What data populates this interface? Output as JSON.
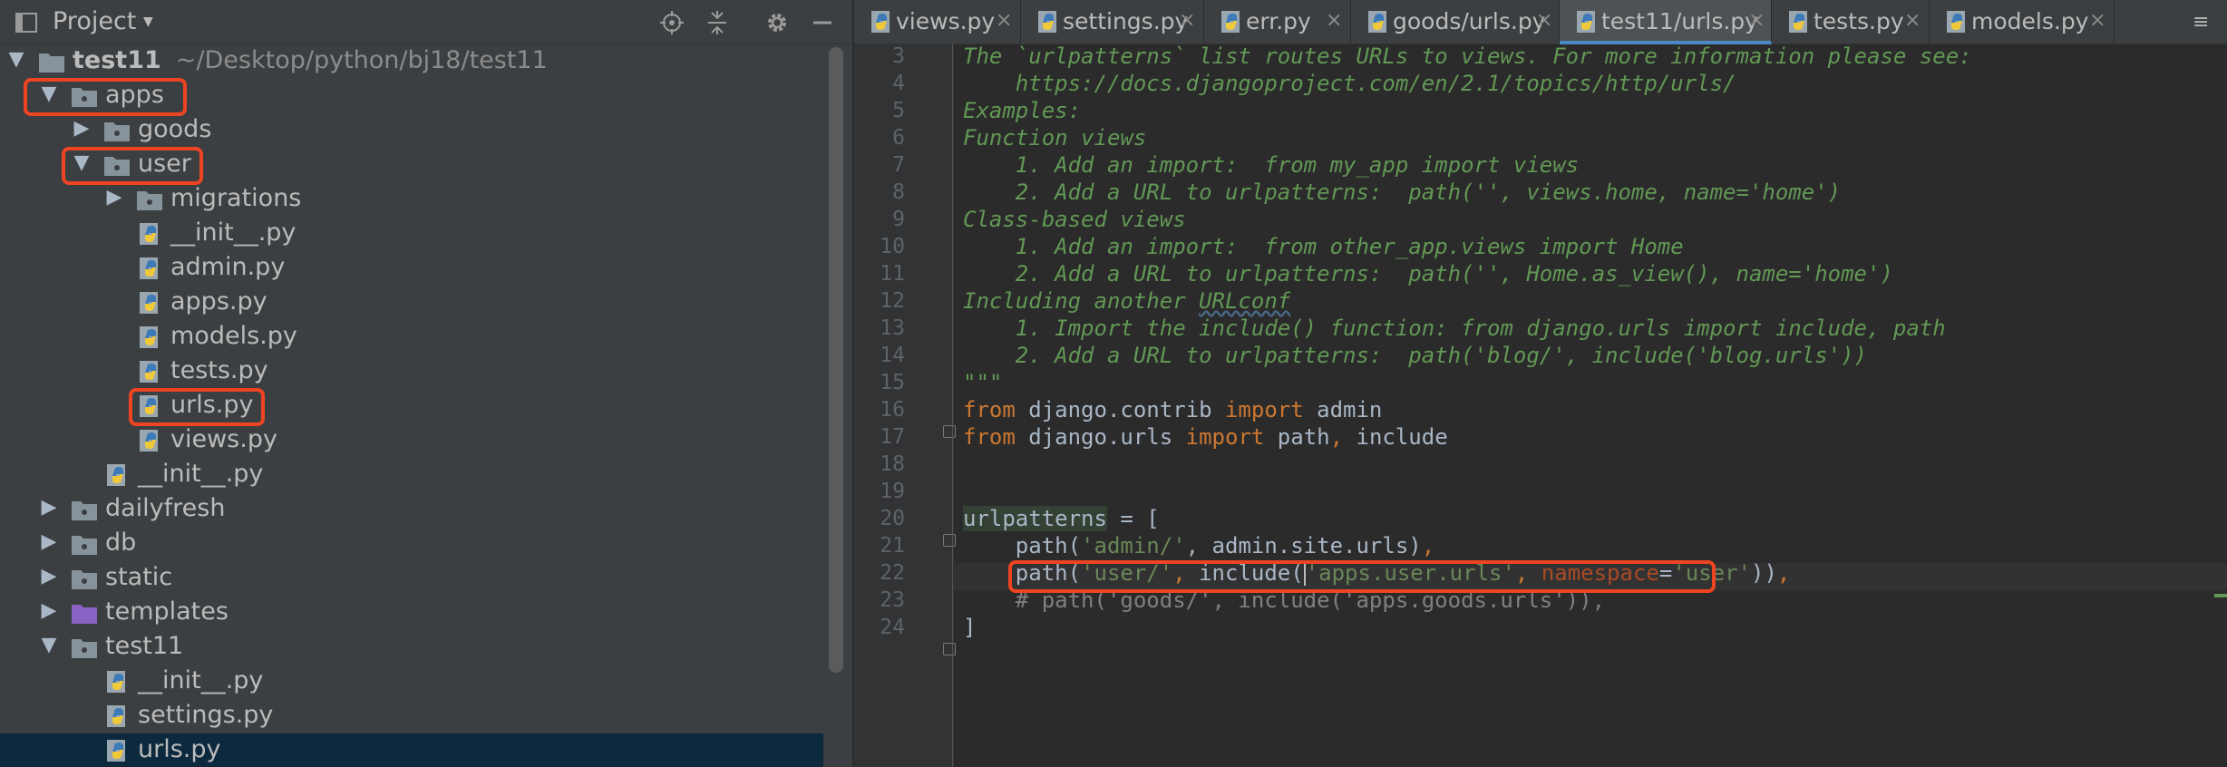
{
  "project_panel": {
    "title": "Project",
    "caret": "▼",
    "tree": [
      {
        "id": "test11",
        "label": "test11",
        "path": "~/Desktop/python/bj18/test11",
        "expanded": true,
        "type": "module"
      },
      {
        "id": "apps",
        "label": "apps",
        "expanded": true,
        "type": "folder"
      },
      {
        "id": "goods",
        "label": "goods",
        "expanded": false,
        "type": "folder"
      },
      {
        "id": "user",
        "label": "user",
        "expanded": true,
        "type": "folder"
      },
      {
        "id": "migrations",
        "label": "migrations",
        "expanded": false,
        "type": "folder"
      },
      {
        "id": "user-init",
        "label": "__init__.py",
        "type": "python"
      },
      {
        "id": "admin",
        "label": "admin.py",
        "type": "python"
      },
      {
        "id": "apps-py",
        "label": "apps.py",
        "type": "python"
      },
      {
        "id": "models",
        "label": "models.py",
        "type": "python"
      },
      {
        "id": "tests",
        "label": "tests.py",
        "type": "python"
      },
      {
        "id": "user-urls",
        "label": "urls.py",
        "type": "python"
      },
      {
        "id": "views",
        "label": "views.py",
        "type": "python"
      },
      {
        "id": "apps-init",
        "label": "__init__.py",
        "type": "python"
      },
      {
        "id": "dailyfresh",
        "label": "dailyfresh",
        "expanded": false,
        "type": "folder"
      },
      {
        "id": "db",
        "label": "db",
        "expanded": false,
        "type": "folder"
      },
      {
        "id": "static",
        "label": "static",
        "expanded": false,
        "type": "folder"
      },
      {
        "id": "templates",
        "label": "templates",
        "expanded": false,
        "type": "templates-folder"
      },
      {
        "id": "test11-pkg",
        "label": "test11",
        "expanded": true,
        "type": "folder"
      },
      {
        "id": "test11-init",
        "label": "__init__.py",
        "type": "python"
      },
      {
        "id": "settings",
        "label": "settings.py",
        "type": "python"
      },
      {
        "id": "test11-urls",
        "label": "urls.py",
        "type": "python",
        "selected": true
      }
    ]
  },
  "tabs": [
    {
      "label": "views.py",
      "close": "×"
    },
    {
      "label": "settings.py",
      "close": "×"
    },
    {
      "label": "err.py",
      "close": "×"
    },
    {
      "label": "goods/urls.py",
      "close": "×"
    },
    {
      "label": "test11/urls.py",
      "close": "×",
      "active": true
    },
    {
      "label": "tests.py",
      "close": "×"
    },
    {
      "label": "models.py",
      "close": "×"
    }
  ],
  "tab_overflow": "≡",
  "editor": {
    "line_numbers": [
      "3",
      "4",
      "5",
      "6",
      "7",
      "8",
      "9",
      "10",
      "11",
      "12",
      "13",
      "14",
      "15",
      "16",
      "17",
      "18",
      "19",
      "20",
      "21",
      "22",
      "23",
      "24"
    ],
    "lines": {
      "l3": "The `urlpatterns` list routes URLs to views. For more information please see:",
      "l4": "    https://docs.djangoproject.com/en/2.1/topics/http/urls/",
      "l5": "Examples:",
      "l6": "Function views",
      "l7": "    1. Add an import:  from my_app import views",
      "l8": "    2. Add a URL to urlpatterns:  path('', views.home, name='home')",
      "l9": "Class-based views",
      "l10": "    1. Add an import:  from other_app.views import Home",
      "l11": "    2. Add a URL to urlpatterns:  path('', Home.as_view(), name='home')",
      "l12a": "Including another ",
      "l12b": "URLconf",
      "l13": "    1. Import the include() function: from django.urls import include, path",
      "l14": "    2. Add a URL to urlpatterns:  path('blog/', include('blog.urls'))",
      "l15": "\"\"\"",
      "l16_kw1": "from",
      "l16_mod": " django.contrib ",
      "l16_kw2": "import",
      "l16_name": " admin",
      "l17_kw1": "from",
      "l17_mod": " django.urls ",
      "l17_kw2": "import",
      "l17_name": " path",
      "l17_comma": ",",
      "l17_name2": " include",
      "l19_ident": "urlpatterns",
      "l19_rest": " = [",
      "l20_a": "    path(",
      "l20_str": "'admin/'",
      "l20_b": ", admin.site.urls)",
      "l20_comma": ",",
      "l21_a": "    path(",
      "l21_str1": "'user/'",
      "l21_comma1": ",",
      "l21_b": " include(",
      "l21_q": "'",
      "l21_str2": "apps.user.urls'",
      "l21_comma2": ",",
      "l21_param": " namespace",
      "l21_eq": "=",
      "l21_str3": "'user'",
      "l21_c": "))",
      "l21_comma3": ",",
      "l22": "    # path('goods/', include('apps.goods.urls')),",
      "l23": "]"
    }
  },
  "colors": {
    "accent": "#4a88c7",
    "highlight": "#ee4422",
    "docstring": "#629755",
    "keyword": "#cc7832",
    "string": "#6a8759"
  }
}
